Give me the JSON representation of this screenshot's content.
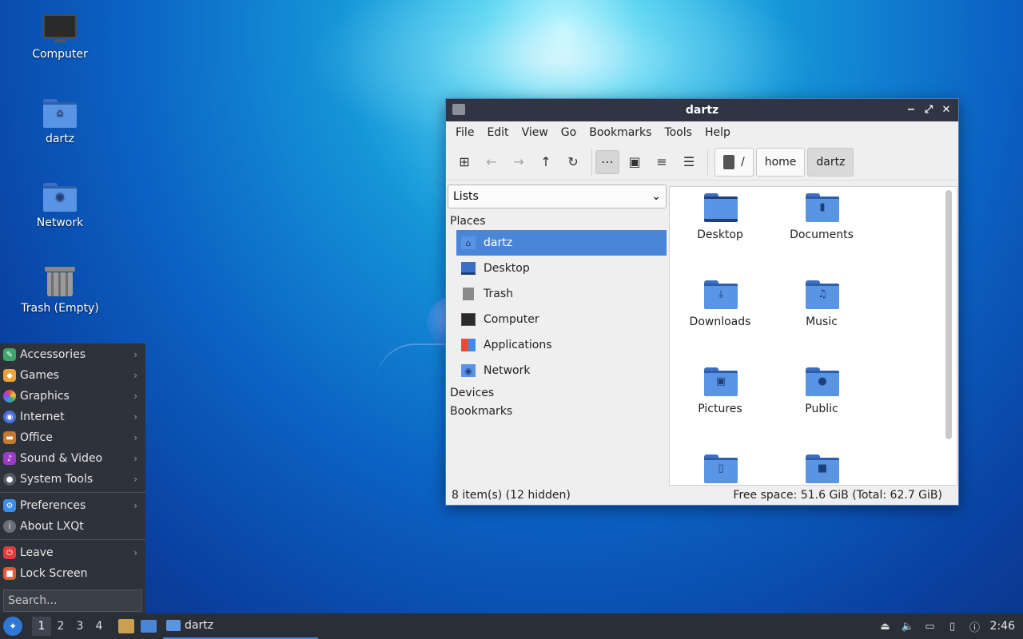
{
  "desktop": {
    "icons": [
      {
        "label": "Computer",
        "icon": "computer-icon"
      },
      {
        "label": "dartz",
        "icon": "home-folder-icon"
      },
      {
        "label": "Network",
        "icon": "network-folder-icon"
      },
      {
        "label": "Trash (Empty)",
        "icon": "trash-icon"
      }
    ]
  },
  "window": {
    "title": "dartz",
    "menu": [
      "File",
      "Edit",
      "View",
      "Go",
      "Bookmarks",
      "Tools",
      "Help"
    ],
    "breadcrumbs": [
      "/",
      "home",
      "dartz"
    ],
    "sidepane_mode": "Lists",
    "sections": {
      "places": "Places",
      "devices": "Devices",
      "bookmarks": "Bookmarks"
    },
    "places": [
      {
        "label": "dartz",
        "icon": "home-icon",
        "selected": true
      },
      {
        "label": "Desktop",
        "icon": "desktop-icon"
      },
      {
        "label": "Trash",
        "icon": "trash-icon"
      },
      {
        "label": "Computer",
        "icon": "computer-icon"
      },
      {
        "label": "Applications",
        "icon": "applications-icon"
      },
      {
        "label": "Network",
        "icon": "network-icon"
      }
    ],
    "files": [
      {
        "label": "Desktop",
        "icon": "desktop-folder-icon"
      },
      {
        "label": "Documents",
        "icon": "documents-folder-icon"
      },
      {
        "label": "Downloads",
        "icon": "downloads-folder-icon"
      },
      {
        "label": "Music",
        "icon": "music-folder-icon"
      },
      {
        "label": "Pictures",
        "icon": "pictures-folder-icon"
      },
      {
        "label": "Public",
        "icon": "public-folder-icon"
      },
      {
        "label": "",
        "icon": "templates-folder-icon"
      },
      {
        "label": "",
        "icon": "videos-folder-icon"
      }
    ],
    "status_left": "8 item(s) (12 hidden)",
    "status_right": "Free space: 51.6 GiB (Total: 62.7 GiB)"
  },
  "start_menu": {
    "items": [
      {
        "label": "Accessories",
        "icon": "accessories-icon",
        "submenu": true
      },
      {
        "label": "Games",
        "icon": "games-icon",
        "submenu": true
      },
      {
        "label": "Graphics",
        "icon": "graphics-icon",
        "submenu": true
      },
      {
        "label": "Internet",
        "icon": "internet-icon",
        "submenu": true
      },
      {
        "label": "Office",
        "icon": "office-icon",
        "submenu": true
      },
      {
        "label": "Sound & Video",
        "icon": "sound-video-icon",
        "submenu": true
      },
      {
        "label": "System Tools",
        "icon": "system-tools-icon",
        "submenu": true
      }
    ],
    "items2": [
      {
        "label": "Preferences",
        "icon": "preferences-icon",
        "submenu": true
      },
      {
        "label": "About LXQt",
        "icon": "info-icon",
        "submenu": false
      }
    ],
    "items3": [
      {
        "label": "Leave",
        "icon": "leave-icon",
        "submenu": true
      },
      {
        "label": "Lock Screen",
        "icon": "lock-icon",
        "submenu": false
      }
    ],
    "search_placeholder": "Search..."
  },
  "taskbar": {
    "desktops": [
      "1",
      "2",
      "3",
      "4"
    ],
    "current_desktop": "1",
    "task_label": "dartz",
    "clock": "2:46"
  },
  "colors": {
    "accent": "#4a86d8",
    "panel": "#2e323a",
    "titlebar": "#2f3542"
  }
}
